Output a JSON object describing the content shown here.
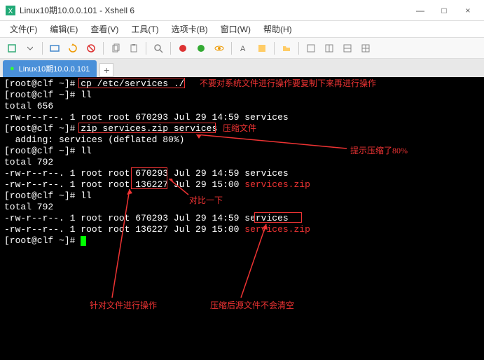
{
  "window": {
    "title": "Linux10期10.0.0.101 - Xshell 6",
    "min": "—",
    "max": "□",
    "close": "×"
  },
  "menu": {
    "file": "文件(F)",
    "edit": "编辑(E)",
    "view": "查看(V)",
    "tools": "工具(T)",
    "tabs": "选项卡(B)",
    "window": "窗口(W)",
    "help": "帮助(H)"
  },
  "tab": {
    "label": "Linux10期10.0.0.101",
    "indicator": "●",
    "add": "+"
  },
  "terminal": {
    "prompt1": "[root@clf ~]# ",
    "cmd1": "cp /etc/services ./",
    "prompt2": "[root@clf ~]# ",
    "cmd2": "ll",
    "total1": "total 656",
    "ls1": "-rw-r--r--. 1 root root 670293 Jul 29 14:59 services",
    "prompt3": "[root@clf ~]# ",
    "cmd3": "zip services.zip services",
    "adding": "  adding: services (deflated 80%)",
    "prompt4": "[root@clf ~]# ",
    "cmd4": "ll",
    "total2": "total 792",
    "ls2a": "-rw-r--r--. 1 root root ",
    "ls2a_size": "670293",
    "ls2a_rest": " Jul 29 14:59 services",
    "ls2b": "-rw-r--r--. 1 root root ",
    "ls2b_size": "136227",
    "ls2b_rest": " Jul 29 15:00 ",
    "ls2b_file": "services.zip",
    "prompt5": "[root@clf ~]# ",
    "cmd5": "ll",
    "total3": "total 792",
    "ls3a": "-rw-r--r--. 1 root root 670293 Jul 29 14:59 ",
    "ls3a_file": "services",
    "ls3b": "-rw-r--r--. 1 root root 136227 Jul 29 15:00 ",
    "ls3b_file": "services.zip",
    "prompt6": "[root@clf ~]# "
  },
  "annotations": {
    "note1": "不要对系统文件进行操作要复制下来再进行操作",
    "note2": "压缩文件",
    "note3": "提示压缩了80%",
    "note4": "对比一下",
    "note5": "针对文件进行操作",
    "note6": "压缩后源文件不会清空"
  }
}
